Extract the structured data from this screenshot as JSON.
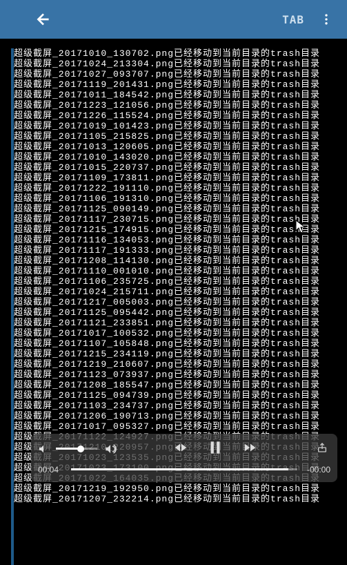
{
  "toolbar": {
    "tab_label": "TAB"
  },
  "player": {
    "current_time": "00:04",
    "remaining_time": "-00:00"
  },
  "terminal_lines": [
    "超级截屏_20171010_130702.png已经移动到当前目录的trash目录",
    "超级截屏_20171024_213304.png已经移动到当前目录的trash目录",
    "超级截屏_20171027_093707.png已经移动到当前目录的trash目录",
    "超级截屏_20171119_201431.png已经移动到当前目录的trash目录",
    "超级截屏_20171011_184542.png已经移动到当前目录的trash目录",
    "超级截屏_20171223_121056.png已经移动到当前目录的trash目录",
    "超级截屏_20171226_115524.png已经移动到当前目录的trash目录",
    "超级截屏_20171019_101423.png已经移动到当前目录的trash目录",
    "超级截屏_20171105_215825.png已经移动到当前目录的trash目录",
    "超级截屏_20171013_120605.png已经移动到当前目录的trash目录",
    "超级截屏_20171010_143020.png已经移动到当前目录的trash目录",
    "超级截屏_20171015_220737.png已经移动到当前目录的trash目录",
    "超级截屏_20171109_173811.png已经移动到当前目录的trash目录",
    "超级截屏_20171222_191110.png已经移动到当前目录的trash目录",
    "超级截屏_20171106_191310.png已经移动到当前目录的trash目录",
    "超级截屏_20171125_090149.png已经移动到当前目录的trash目录",
    "超级截屏_20171117_230715.png已经移动到当前目录的trash目录",
    "超级截屏_20171215_174915.png已经移动到当前目录的trash目录",
    "超级截屏_20171116_134053.png已经移动到当前目录的trash目录",
    "超级截屏_20171117_191333.png已经移动到当前目录的trash目录",
    "超级截屏_20171208_114130.png已经移动到当前目录的trash目录",
    "超级截屏_20171110_001010.png已经移动到当前目录的trash目录",
    "超级截屏_20171106_235725.png已经移动到当前目录的trash目录",
    "超级截屏_20171024_215711.png已经移动到当前目录的trash目录",
    "超级截屏_20171217_005003.png已经移动到当前目录的trash目录",
    "超级截屏_20171125_095442.png已经移动到当前目录的trash目录",
    "超级截屏_20171121_233851.png已经移动到当前目录的trash目录",
    "超级截屏_20171017_100532.png已经移动到当前目录的trash目录",
    "超级截屏_20171107_105848.png已经移动到当前目录的trash目录",
    "超级截屏_20171215_234119.png已经移动到当前目录的trash目录",
    "超级截屏_20171219_210607.png已经移动到当前目录的trash目录",
    "超级截屏_20171123_073937.png已经移动到当前目录的trash目录",
    "超级截屏_20171208_185547.png已经移动到当前目录的trash目录",
    "超级截屏_20171125_094739.png已经移动到当前目录的trash目录",
    "超级截屏_20171103_234737.png已经移动到当前目录的trash目录",
    "超级截屏_20171206_190713.png已经移动到当前目录的trash目录",
    "超级截屏_20171017_095327.png已经移动到当前目录的trash目录",
    "超级截屏_20171122_124927.png已经移动到当前目录的trash目录",
    "超级截屏_20171210_220957.png已经移动到当前目录的trash目录",
    "超级截屏_20171023_123535.png已经移动到当前目录的trash目录",
    "超级截屏_20171023_173100.png已经移动到当前目录的trash目录",
    "超级截屏_20171022_164035.png已经移动到当前目录的trash目录",
    "超级截屏_20171219_192950.png已经移动到当前目录的trash目录",
    "超级截屏_20171207_232214.png已经移动到当前目录的trash目录"
  ]
}
